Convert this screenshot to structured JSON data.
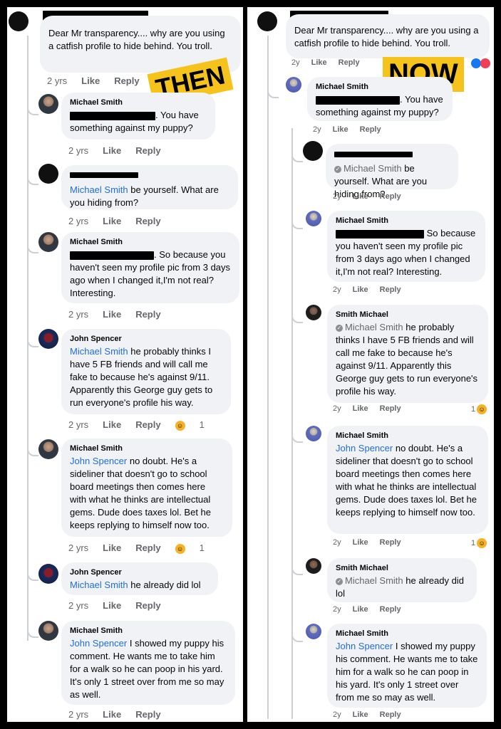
{
  "labels": {
    "then": "THEN",
    "now": "NOW"
  },
  "left": {
    "c0": {
      "text": "Dear Mr transparency.... why are you using a catfish profile to hide behind. You troll.",
      "time": "2 yrs",
      "like": "Like",
      "reply": "Reply"
    },
    "c1": {
      "author": "Michael Smith",
      "text_a": ". You have",
      "text_b": "something against my puppy?",
      "time": "2 yrs",
      "like": "Like",
      "reply": "Reply"
    },
    "c2": {
      "mention": "Michael Smith",
      "text": " be yourself. What are you hiding from?",
      "time": "2 yrs",
      "like": "Like",
      "reply": "Reply"
    },
    "c3": {
      "author": "Michael Smith",
      "text_a": ". So because you",
      "text_b": "haven't seen my profile pic from 3 days ago when I changed it,I'm not real? Interesting.",
      "time": "2 yrs",
      "like": "Like",
      "reply": "Reply"
    },
    "c4": {
      "author": "John Spencer",
      "mention": "Michael Smith",
      "text": " he probably thinks I have 5 FB friends and will call me fake to because he's against 9/11. Apparently this George guy gets to run everyone's profile his way.",
      "time": "2 yrs",
      "like": "Like",
      "reply": "Reply",
      "react_count": "1"
    },
    "c5": {
      "author": "Michael Smith",
      "mention": "John Spencer",
      "text": " no doubt. He's a sideliner that doesn't go to school board meetings then comes here with what he thinks are intellectual gems. Dude does taxes lol. Bet he keeps replying to himself now too.",
      "time": "2 yrs",
      "like": "Like",
      "reply": "Reply",
      "react_count": "1"
    },
    "c6": {
      "author": "John Spencer",
      "mention": "Michael Smith",
      "text": " he already did lol",
      "time": "2 yrs",
      "like": "Like",
      "reply": "Reply"
    },
    "c7": {
      "author": "Michael Smith",
      "mention": "John Spencer",
      "text": " I showed my puppy his comment. He wants me to take him for a walk so he can poop in his yard. It's only 1 street over from me so may as well.",
      "time": "2 yrs",
      "like": "Like",
      "reply": "Reply"
    }
  },
  "right": {
    "c0": {
      "text": "Dear Mr transparency.... why are you using a catfish profile to hide behind. You troll.",
      "time": "2y",
      "like": "Like",
      "reply": "Reply"
    },
    "c1": {
      "author": "Michael Smith",
      "text_a": ". You have",
      "text_b": "something against my puppy?",
      "time": "2y",
      "like": "Like",
      "reply": "Reply"
    },
    "c2": {
      "mention": "Michael Smith",
      "text": " be yourself. What are you hiding from?",
      "time": "2y",
      "like": "Like",
      "reply": "Reply"
    },
    "c3": {
      "author": "Michael Smith",
      "text_a": " So because",
      "text_b": "you haven't seen my profile pic from 3 days ago when I changed it,I'm not real? Interesting.",
      "time": "2y",
      "like": "Like",
      "reply": "Reply"
    },
    "c4": {
      "author": "Smith Michael",
      "mention": "Michael Smith",
      "text": " he probably thinks I have 5 FB friends and will call me fake to because he's against 9/11. Apparently this George guy gets to run everyone's profile his way.",
      "time": "2y",
      "like": "Like",
      "reply": "Reply",
      "react_count": "1"
    },
    "c5": {
      "author": "Michael Smith",
      "mention": "John Spencer",
      "text": " no doubt. He's a sideliner that doesn't go to school board meetings then comes here with what he thinks are intellectual gems. Dude does taxes lol. Bet he keeps replying to himself now too.",
      "time": "2y",
      "like": "Like",
      "reply": "Reply",
      "react_count": "1"
    },
    "c6": {
      "author": "Smith Michael",
      "mention": "Michael Smith",
      "text": " he already did lol",
      "time": "2y",
      "like": "Like",
      "reply": "Reply"
    },
    "c7": {
      "author": "Michael Smith",
      "mention": "John Spencer",
      "text": " I showed my puppy his comment. He wants me to take him for a walk so he can poop in his yard. It's only 1 street over from me so may as well.",
      "time": "2y",
      "like": "Like",
      "reply": "Reply"
    }
  }
}
